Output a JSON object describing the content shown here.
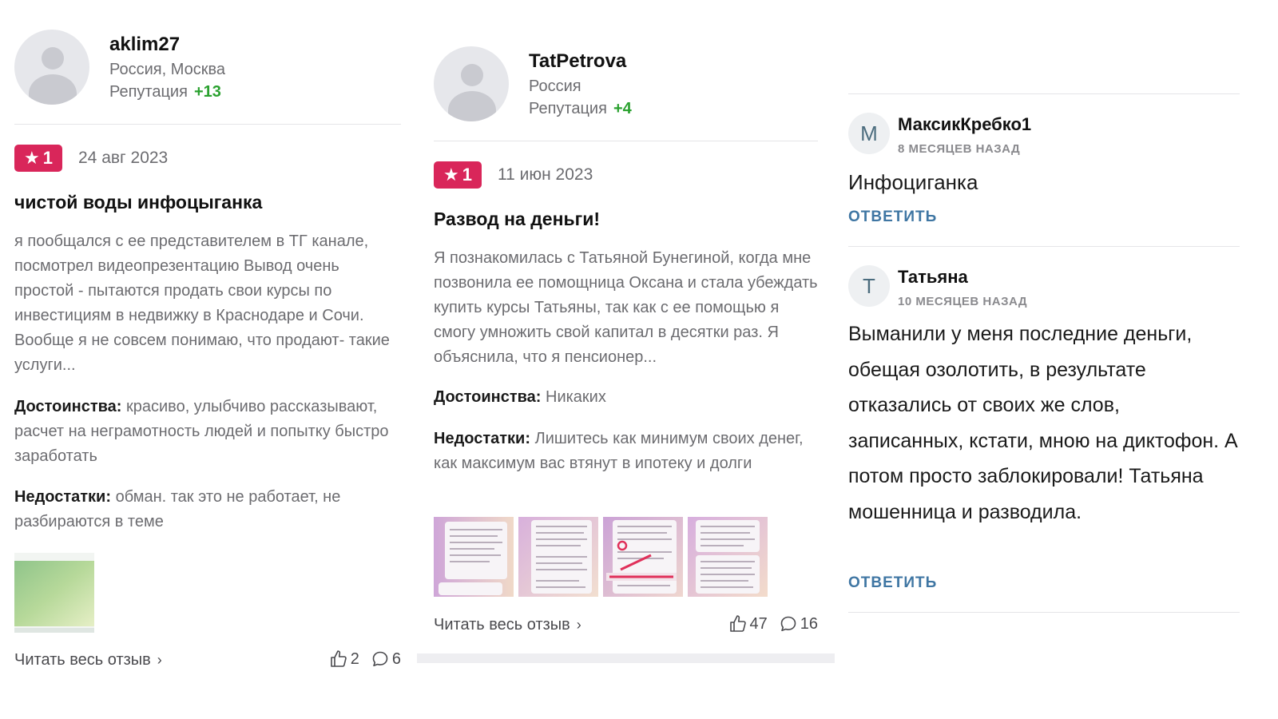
{
  "reviews": [
    {
      "username": "aklim27",
      "location": "Россия, Москва",
      "reputation_label": "Репутация",
      "reputation_value": "+13",
      "rating": "1",
      "date": "24 авг 2023",
      "title": "чистой воды инфоцыганка",
      "text": "я пообщался с ее представителем в ТГ канале, посмотрел видеопрезентацию Вывод очень простой - пытаются продать свои курсы по инвестициям в недвижку в Краснодаре и Сочи. Вообще я не совсем понимаю, что продают- такие услуги...",
      "pros_label": "Достоинства:",
      "pros": "красиво, улыбчиво рассказывают, расчет на неграмотность людей и попытку быстро заработать",
      "cons_label": "Недостатки:",
      "cons": "обман. так это не работает, не разбираются в теме",
      "read_more": "Читать весь отзыв",
      "likes": "2",
      "comments": "6"
    },
    {
      "username": "TatPetrova",
      "location": "Россия",
      "reputation_label": "Репутация",
      "reputation_value": "+4",
      "rating": "1",
      "date": "11 июн 2023",
      "title": "Развод на деньги!",
      "text": "Я познакомилась с Татьяной Бунегиной, когда мне позвонила ее помощница Оксана и стала убеждать купить курсы Татьяны, так как с ее помощью я смогу умножить свой капитал в десятки раз. Я объяснила, что я пенсионер...",
      "pros_label": "Достоинства:",
      "pros": "Никаких",
      "cons_label": "Недостатки:",
      "cons": "Лишитесь как минимум своих денег, как максимум вас втянут в ипотеку и долги",
      "read_more": "Читать весь отзыв",
      "likes": "47",
      "comments": "16"
    }
  ],
  "comments": [
    {
      "initial": "М",
      "name": "МаксикКребко1",
      "time": "8 МЕСЯЦЕВ НАЗАД",
      "text": "Инфоциганка",
      "reply": "ОТВЕТИТЬ"
    },
    {
      "initial": "Т",
      "name": "Татьяна",
      "time": "10 МЕСЯЦЕВ НАЗАД",
      "text": "Выманили у меня последние деньги, обещая озолотить, в результате отказались от своих же слов, записанных, кстати, мною на диктофон. А потом просто заблокировали! Татьяна мошенница и разводила.",
      "reply": "ОТВЕТИТЬ"
    }
  ],
  "colors": {
    "badge": "#d9265a",
    "reputation": "#2aa12f",
    "reply_link": "#3f76a3"
  },
  "icons": [
    "star-icon",
    "thumbs-up-icon",
    "comment-icon",
    "chevron-right-icon"
  ]
}
